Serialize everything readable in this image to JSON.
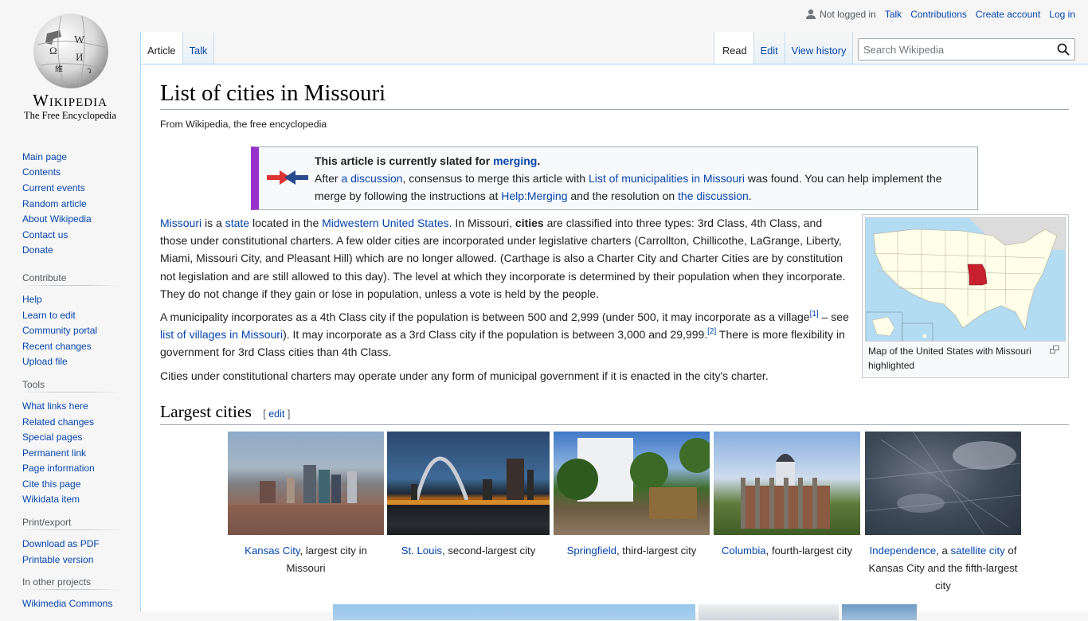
{
  "logo": {
    "wordmark": "Wikipedia",
    "tagline": "The Free Encyclopedia"
  },
  "sidebar": {
    "navigation": [
      {
        "label": "Main page"
      },
      {
        "label": "Contents"
      },
      {
        "label": "Current events"
      },
      {
        "label": "Random article"
      },
      {
        "label": "About Wikipedia"
      },
      {
        "label": "Contact us"
      },
      {
        "label": "Donate"
      }
    ],
    "contribute": {
      "heading": "Contribute",
      "items": [
        {
          "label": "Help"
        },
        {
          "label": "Learn to edit"
        },
        {
          "label": "Community portal"
        },
        {
          "label": "Recent changes"
        },
        {
          "label": "Upload file"
        }
      ]
    },
    "tools": {
      "heading": "Tools",
      "items": [
        {
          "label": "What links here"
        },
        {
          "label": "Related changes"
        },
        {
          "label": "Special pages"
        },
        {
          "label": "Permanent link"
        },
        {
          "label": "Page information"
        },
        {
          "label": "Cite this page"
        },
        {
          "label": "Wikidata item"
        }
      ]
    },
    "print": {
      "heading": "Print/export",
      "items": [
        {
          "label": "Download as PDF"
        },
        {
          "label": "Printable version"
        }
      ]
    },
    "projects": {
      "heading": "In other projects",
      "items": [
        {
          "label": "Wikimedia Commons"
        }
      ]
    }
  },
  "personal": {
    "status": "Not logged in",
    "links": [
      "Talk",
      "Contributions",
      "Create account",
      "Log in"
    ]
  },
  "tabs": {
    "namespaces": [
      {
        "label": "Article",
        "selected": true
      },
      {
        "label": "Talk",
        "selected": false
      }
    ],
    "views": [
      {
        "label": "Read",
        "selected": true
      },
      {
        "label": "Edit",
        "selected": false
      },
      {
        "label": "View history",
        "selected": false
      }
    ]
  },
  "search": {
    "placeholder": "Search Wikipedia",
    "value": ""
  },
  "article": {
    "title": "List of cities in Missouri",
    "subtitle": "From Wikipedia, the free encyclopedia",
    "merge_notice": {
      "line1_bold": "This article is currently slated for ",
      "line1_link": "merging",
      "line1_end": ".",
      "t1": "After ",
      "l1": "a discussion",
      "t2": ", consensus to merge this article with ",
      "l2": "List of municipalities in Missouri",
      "t3": " was found. You can help implement the merge by following the instructions at ",
      "l3": "Help:Merging",
      "t4": " and the resolution on ",
      "l4": "the discussion",
      "t5": "."
    },
    "para1": {
      "l1": "Missouri",
      "t1": " is a ",
      "l2": "state",
      "t2": " located in the ",
      "l3": "Midwestern United States",
      "t3": ". In Missouri, ",
      "b1": "cities",
      "t4": " are classified into three types: 3rd Class, 4th Class, and those under constitutional charters. A few older cities are incorporated under legislative charters (Carrollton, Chillicothe, LaGrange, Liberty, Miami, Missouri City, and Pleasant Hill) which are no longer allowed. (Carthage is also a Charter City and Charter Cities are by constitution not legislation and are still allowed to this day). The level at which they incorporate is determined by their population when they incorporate. They do not change if they gain or lose in population, unless a vote is held by the people."
    },
    "para2": {
      "t1": "A municipality incorporates as a 4th Class city if the population is between 500 and 2,999 (under 500, it may incorporate as a village",
      "ref1": "[1]",
      "t2": " – see ",
      "l1": "list of villages in Missouri",
      "t3": "). It may incorporate as a 3rd Class city if the population is between 3,000 and 29,999.",
      "ref2": "[2]",
      "t4": " There is more flexibility in government for 3rd Class cities than 4th Class."
    },
    "para3": "Cities under constitutional charters may operate under any form of municipal government if it is enacted in the city's charter.",
    "thumb_caption": "Map of the United States with Missouri highlighted",
    "section": {
      "title": "Largest cities",
      "edit_open": "[ ",
      "edit_label": "edit",
      "edit_close": " ]"
    },
    "gallery": [
      {
        "link": "Kansas City",
        "text": ", largest city in Missouri"
      },
      {
        "link": "St. Louis",
        "text": ", second-largest city"
      },
      {
        "link": "Springfield",
        "text": ", third-largest city"
      },
      {
        "link": "Columbia",
        "text": ", fourth-largest city"
      },
      {
        "link": "Independence",
        "text_mid": ", a ",
        "link2": "satellite city",
        "text": " of Kansas City and the fifth-largest city"
      }
    ]
  },
  "colors": {
    "link": "#0645ad",
    "merge_bar": "#9932cc",
    "missouri_highlight": "#c8202f"
  }
}
